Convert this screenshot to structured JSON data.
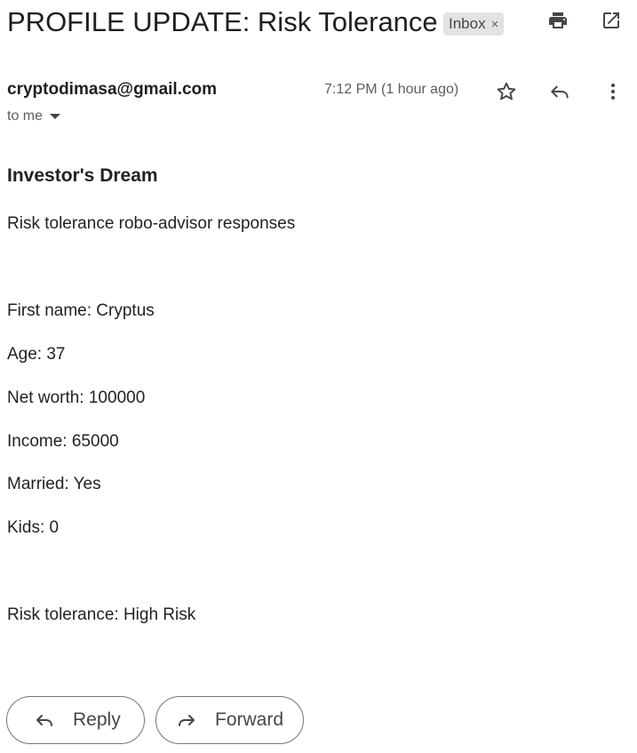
{
  "email": {
    "subject": "PROFILE UPDATE: Risk Tolerance",
    "label": "Inbox",
    "label_close": "×",
    "sender": "cryptodimasa@gmail.com",
    "recipient": "to me",
    "timestamp": "7:12 PM (1 hour ago)"
  },
  "body": {
    "title": "Investor's Dream",
    "subtitle": "Risk tolerance robo-advisor responses",
    "fields": [
      "First name: Cryptus",
      "Age: 37",
      "Net worth: 100000",
      "Income: 65000",
      "Married: Yes",
      "Kids: 0"
    ],
    "risk": "Risk tolerance: High Risk"
  },
  "actions": {
    "reply_label": "Reply",
    "forward_label": "Forward"
  },
  "icons": {
    "print": "print-icon",
    "open_new_window": "open-in-new-icon",
    "star": "star-icon",
    "reply": "reply-icon",
    "more": "more-vert-icon",
    "forward": "forward-icon"
  }
}
